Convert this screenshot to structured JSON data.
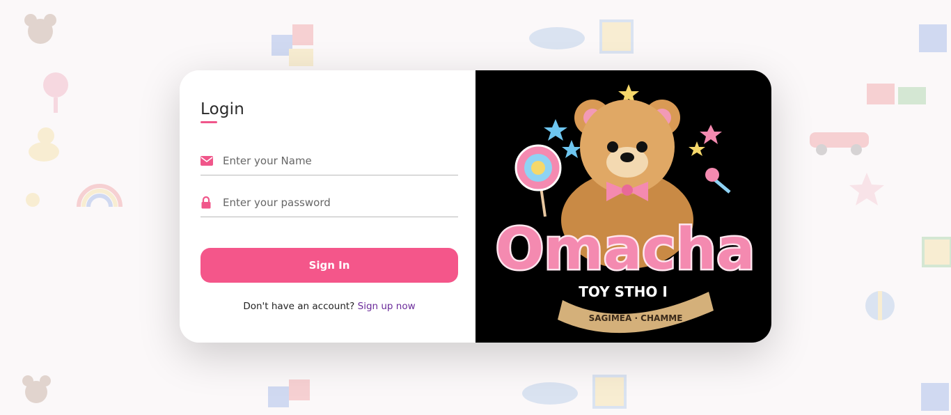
{
  "login": {
    "title": "Login",
    "name_placeholder": "Enter your Name",
    "password_placeholder": "Enter your password",
    "signin_label": "Sign In",
    "signup_prompt": "Don't have an account?",
    "signup_link": "Sign up now"
  },
  "logo": {
    "wordmark": "Omacha",
    "tagline": "TOY STHO I",
    "ribbon_text": "SAGIMEA · CHAMME"
  },
  "colors": {
    "accent": "#f4568a",
    "link": "#6a2a9a",
    "logo_bg": "#000000"
  },
  "icons": {
    "name_field": "envelope-icon",
    "password_field": "lock-icon"
  }
}
